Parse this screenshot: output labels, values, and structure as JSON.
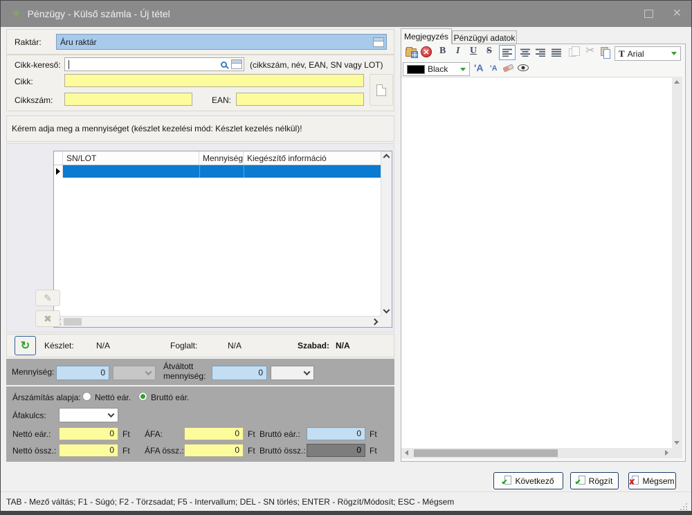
{
  "window": {
    "title": "Pénzügy - Külső számla - Új tétel"
  },
  "icons": {
    "app": "✳",
    "close": "×",
    "refresh": "↻",
    "edit": "✎",
    "delete": "✖",
    "scissors": "✂",
    "bold": "B",
    "italic": "I",
    "underline": "U",
    "strike": "S",
    "font": "T",
    "font_up": "'A",
    "font_down": "'A",
    "check": "✔",
    "cancel": "✘"
  },
  "colors": {
    "titlebar": "#8a8a8a",
    "selection_blue": "#0b7ad1",
    "field_yellow": "#fdfc9c",
    "field_blue": "#c3ddf2",
    "radio_green": "#2fa02f",
    "button_border": "#1c3a66"
  },
  "form": {
    "raktar": {
      "label": "Raktár:",
      "value": "Áru raktár"
    },
    "cikk_kereso": {
      "label": "Cikk-kereső:",
      "value": "",
      "hint": "(cikkszám, név, EAN, SN vagy LOT)"
    },
    "cikk": {
      "label": "Cikk:",
      "value": ""
    },
    "cikkszam": {
      "label": "Cikkszám:",
      "value": ""
    },
    "ean": {
      "label": "EAN:",
      "value": ""
    },
    "message": "Kérem adja meg a mennyiséget (készlet kezelési mód: Készlet kezelés nélkül)!"
  },
  "table": {
    "columns": [
      "SN/LOT",
      "Mennyiség",
      "Kiegészítő információ"
    ]
  },
  "stock": {
    "keszlet_label": "Készlet:",
    "keszlet_value": "N/A",
    "foglalt_label": "Foglalt:",
    "foglalt_value": "N/A",
    "szabad_label": "Szabad:",
    "szabad_value": "N/A"
  },
  "quantity": {
    "label": "Mennyiség:",
    "value": "0",
    "converted_label_line1": "Átváltott",
    "converted_label_line2": "mennyiség:",
    "converted_value": "0"
  },
  "pricing": {
    "base_label": "Árszámítás alapja:",
    "netto_option": "Nettó eár.",
    "brutto_option": "Bruttó eár.",
    "afakulcs_label": "Áfakulcs:",
    "afakulcs_value": "",
    "unit": "Ft",
    "netto_ear_label": "Nettó eár.:",
    "netto_ear_value": "0",
    "afa_label": "ÁFA:",
    "afa_value": "0",
    "brutto_ear_label": "Bruttó eár.:",
    "brutto_ear_value": "0",
    "netto_ossz_label": "Nettó össz.:",
    "netto_ossz_value": "0",
    "afa_ossz_label": "ÁFA össz.:",
    "afa_ossz_value": "0",
    "brutto_ossz_label": "Bruttó össz.:",
    "brutto_ossz_value": "0"
  },
  "editor": {
    "tab_megjegyzes": "Megjegyzés",
    "tab_penzugyi": "Pénzügyi adatok",
    "font_name": "Arial",
    "color_name": "Black"
  },
  "footer": {
    "next": "Következő",
    "save": "Rögzít",
    "cancel": "Mégsem",
    "status": "TAB - Mező váltás; F1 - Súgó; F2 - Törzsadat; F5 - Intervallum; DEL - SN törlés; ENTER - Rögzít/Módosít; ESC - Mégsem"
  }
}
